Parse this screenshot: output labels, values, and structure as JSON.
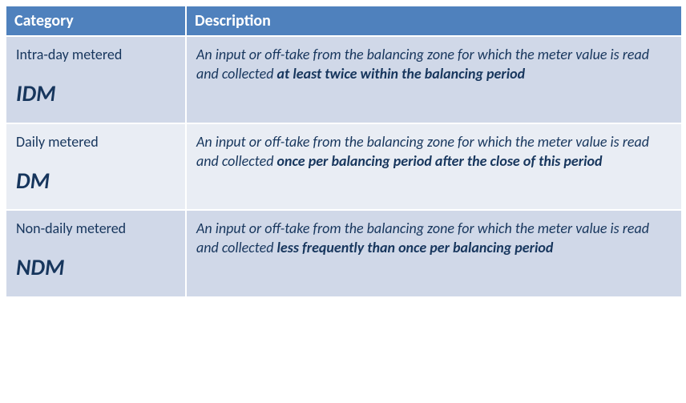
{
  "table": {
    "headers": {
      "category": "Category",
      "description": "Description"
    },
    "rows": [
      {
        "label": "Intra-day metered",
        "abbr": "IDM",
        "desc_pre": "An input or off-take from the balancing zone for which the meter value is read and collected ",
        "desc_bold": "at least twice within the balancing period"
      },
      {
        "label": "Daily metered",
        "abbr": "DM",
        "desc_pre": "An input or off-take from the balancing zone for which the meter value is read and collected ",
        "desc_bold": "once per balancing period after the close of this period"
      },
      {
        "label": "Non-daily metered",
        "abbr": "NDM",
        "desc_pre": "An input or off-take from the balancing zone for which the meter value is read and collected ",
        "desc_bold": "less frequently than once per balancing period"
      }
    ]
  }
}
